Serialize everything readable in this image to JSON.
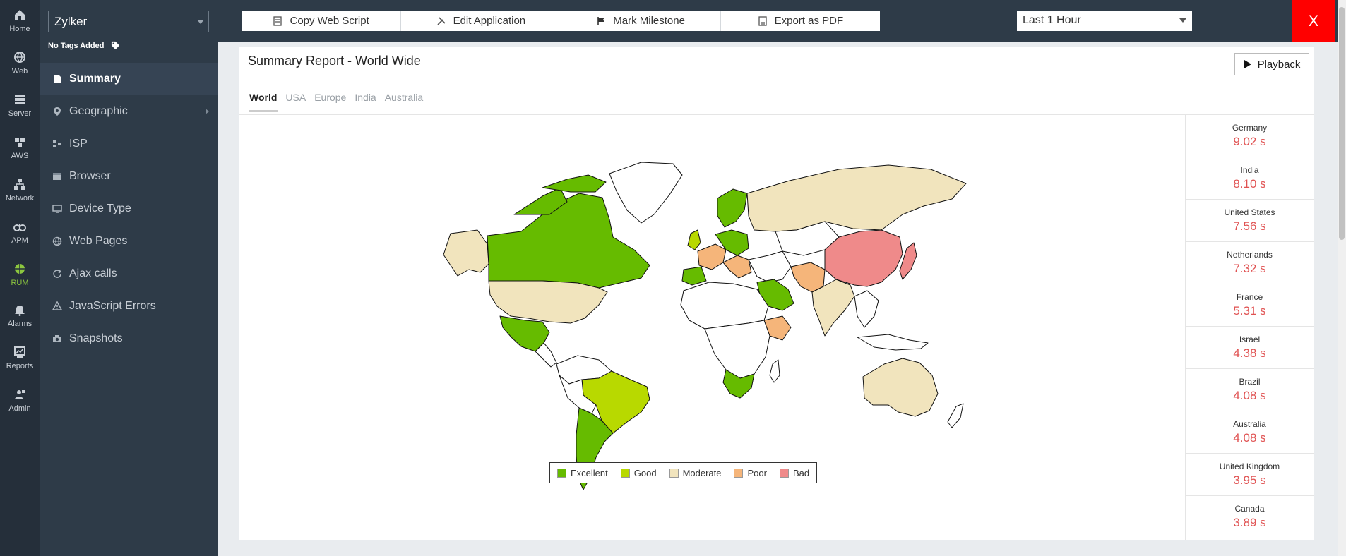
{
  "rail": [
    {
      "label": "Home",
      "icon": "home-icon"
    },
    {
      "label": "Web",
      "icon": "globe-icon"
    },
    {
      "label": "Server",
      "icon": "server-icon"
    },
    {
      "label": "AWS",
      "icon": "aws-icon"
    },
    {
      "label": "Network",
      "icon": "network-icon"
    },
    {
      "label": "APM",
      "icon": "apm-icon"
    },
    {
      "label": "RUM",
      "icon": "rum-icon",
      "active": true
    },
    {
      "label": "Alarms",
      "icon": "alarm-bell-icon"
    },
    {
      "label": "Reports",
      "icon": "reports-icon"
    },
    {
      "label": "Admin",
      "icon": "admin-icon"
    }
  ],
  "sidebar": {
    "app_name": "Zylker",
    "tags_label": "No Tags Added",
    "items": [
      {
        "label": "Summary",
        "icon": "document-icon",
        "active": true
      },
      {
        "label": "Geographic",
        "icon": "location-pin-icon",
        "has_submenu": true
      },
      {
        "label": "ISP",
        "icon": "isp-icon"
      },
      {
        "label": "Browser",
        "icon": "browser-icon"
      },
      {
        "label": "Device Type",
        "icon": "monitor-icon"
      },
      {
        "label": "Web Pages",
        "icon": "globe-icon"
      },
      {
        "label": "Ajax calls",
        "icon": "refresh-icon"
      },
      {
        "label": "JavaScript Errors",
        "icon": "warning-icon"
      },
      {
        "label": "Snapshots",
        "icon": "camera-icon"
      }
    ]
  },
  "toolbar": {
    "copy_script": "Copy Web Script",
    "edit_app": "Edit Application",
    "milestone": "Mark Milestone",
    "export_pdf": "Export as PDF",
    "time_range": "Last 1 Hour",
    "close": "X"
  },
  "main": {
    "title": "Summary Report - World Wide",
    "playback": "Playback",
    "tabs": [
      "World",
      "USA",
      "Europe",
      "India",
      "Australia"
    ],
    "active_tab": "World"
  },
  "legend": [
    {
      "label": "Excellent",
      "color": "#66bb00"
    },
    {
      "label": "Good",
      "color": "#b8d900"
    },
    {
      "label": "Moderate",
      "color": "#f1e4bd"
    },
    {
      "label": "Poor",
      "color": "#f5b57a"
    },
    {
      "label": "Bad",
      "color": "#ef8a8a"
    }
  ],
  "rankings": [
    {
      "country": "Germany",
      "value": "9.02 s"
    },
    {
      "country": "India",
      "value": "8.10 s"
    },
    {
      "country": "United States",
      "value": "7.56 s"
    },
    {
      "country": "Netherlands",
      "value": "7.32 s"
    },
    {
      "country": "France",
      "value": "5.31 s"
    },
    {
      "country": "Israel",
      "value": "4.38 s"
    },
    {
      "country": "Brazil",
      "value": "4.08 s"
    },
    {
      "country": "Australia",
      "value": "4.08 s"
    },
    {
      "country": "United Kingdom",
      "value": "3.95 s"
    },
    {
      "country": "Canada",
      "value": "3.89 s"
    }
  ]
}
